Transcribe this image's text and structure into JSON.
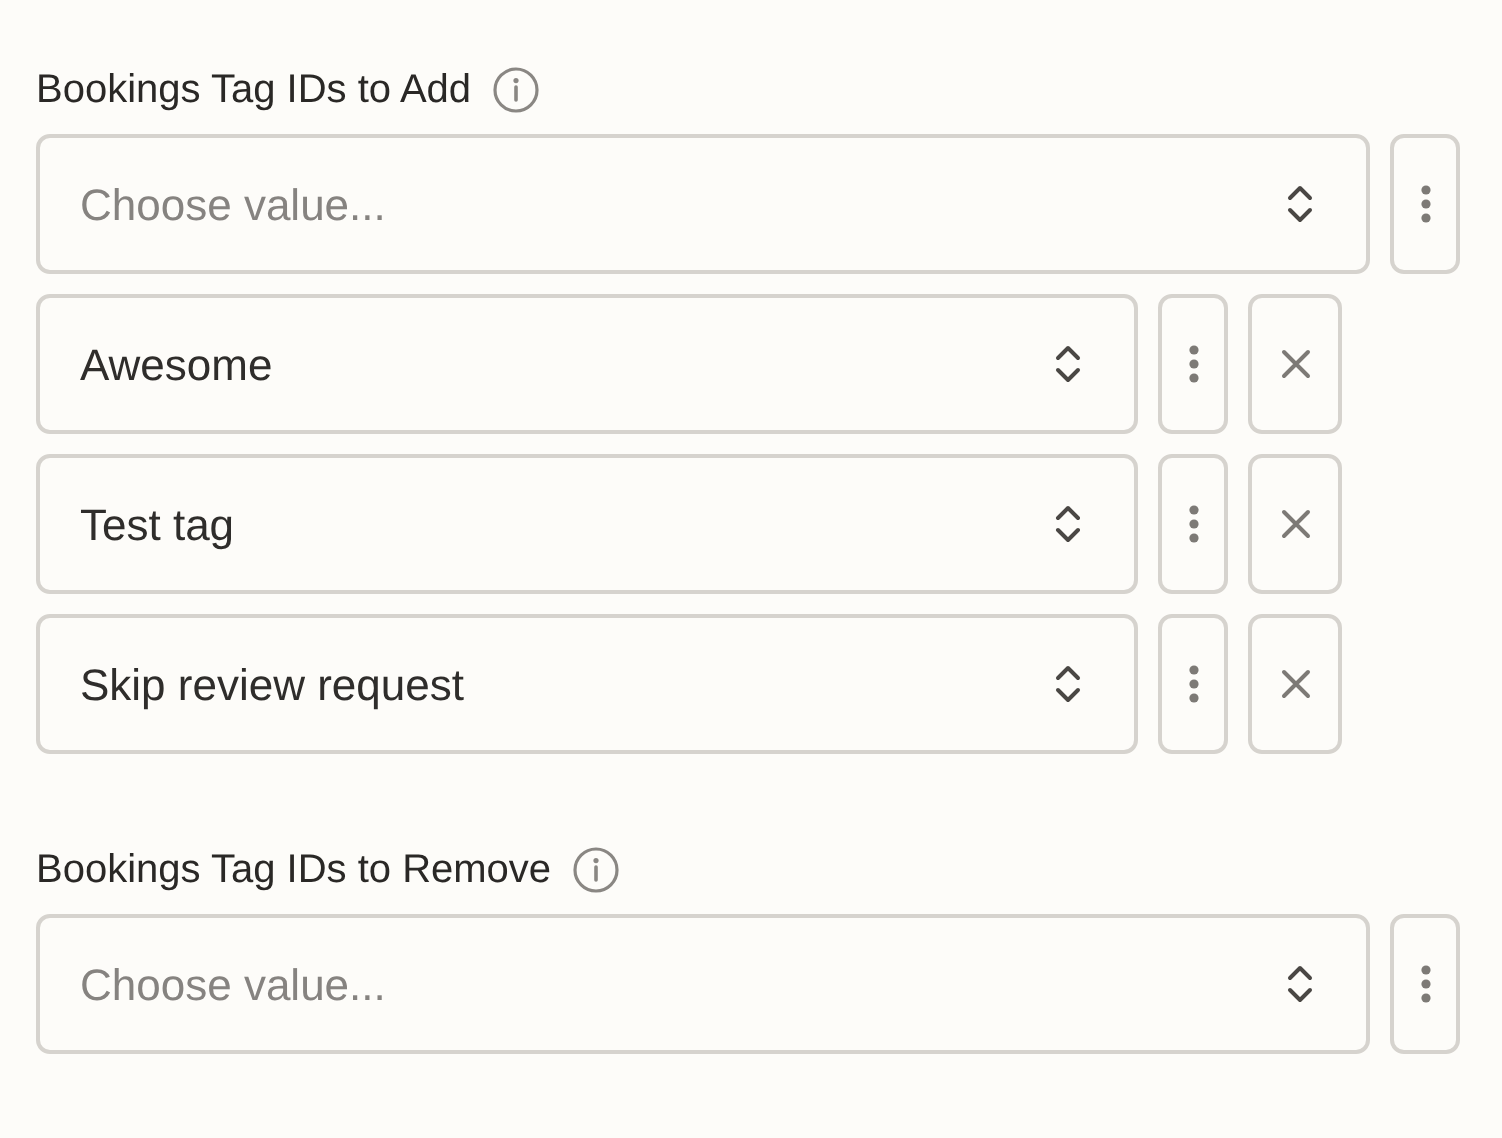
{
  "fields": [
    {
      "label": "Bookings Tag IDs to Add",
      "select": {
        "placeholder": "Choose value..."
      },
      "values": [
        {
          "value": "Awesome"
        },
        {
          "value": "Test tag"
        },
        {
          "value": "Skip review request"
        }
      ]
    },
    {
      "label": "Bookings Tag IDs to Remove",
      "select": {
        "placeholder": "Choose value..."
      }
    }
  ]
}
